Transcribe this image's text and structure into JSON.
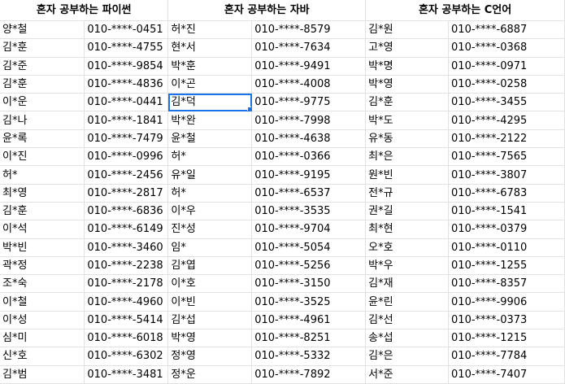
{
  "colors": {
    "grid": "#e2e2e2",
    "selection": "#1a73e8"
  },
  "groups": [
    {
      "title": "혼자 공부하는 파이썬"
    },
    {
      "title": "혼자 공부하는 자바"
    },
    {
      "title": "혼자 공부하는 C언어"
    }
  ],
  "rows": [
    [
      "양*철",
      "010-****-0451",
      "허*진",
      "010-****-8579",
      "김*원",
      "010-****-6887"
    ],
    [
      "김*훈",
      "010-****-4755",
      "현*서",
      "010-****-7634",
      "고*영",
      "010-****-0368"
    ],
    [
      "김*준",
      "010-****-9854",
      "박*훈",
      "010-****-9491",
      "박*명",
      "010-****-0971"
    ],
    [
      "김*훈",
      "010-****-4836",
      "이*곤",
      "010-****-4008",
      "박*영",
      "010-****-0258"
    ],
    [
      "이*운",
      "010-****-0441",
      "김*덕",
      "010-****-9775",
      "김*훈",
      "010-****-3455"
    ],
    [
      "김*나",
      "010-****-1841",
      "박*완",
      "010-****-7998",
      "박*도",
      "010-****-4295"
    ],
    [
      "윤*록",
      "010-****-7479",
      "윤*철",
      "010-****-4638",
      "유*동",
      "010-****-2122"
    ],
    [
      "이*진",
      "010-****-0996",
      "허*",
      "010-****-0366",
      "최*은",
      "010-****-7565"
    ],
    [
      "허*",
      "010-****-2456",
      "유*일",
      "010-****-9195",
      "원*빈",
      "010-****-3807"
    ],
    [
      "최*영",
      "010-****-2817",
      "허*",
      "010-****-6537",
      "전*규",
      "010-****-6783"
    ],
    [
      "김*훈",
      "010-****-6836",
      "이*우",
      "010-****-3535",
      "권*길",
      "010-****-1541"
    ],
    [
      "이*석",
      "010-****-6149",
      "진*성",
      "010-****-9704",
      "최*현",
      "010-****-0379"
    ],
    [
      "박*빈",
      "010-****-3460",
      "임*",
      "010-****-5054",
      "오*호",
      "010-****-0110"
    ],
    [
      "곽*정",
      "010-****-2238",
      "김*엽",
      "010-****-5256",
      "박*우",
      "010-****-1255"
    ],
    [
      "조*숙",
      "010-****-2178",
      "이*호",
      "010-****-3150",
      "김*재",
      "010-****-8357"
    ],
    [
      "이*철",
      "010-****-4960",
      "이*빈",
      "010-****-3525",
      "윤*린",
      "010-****-9906"
    ],
    [
      "이*성",
      "010-****-5414",
      "김*섭",
      "010-****-4961",
      "김*선",
      "010-****-0373"
    ],
    [
      "심*미",
      "010-****-6018",
      "박*영",
      "010-****-8251",
      "송*섭",
      "010-****-1215"
    ],
    [
      "신*호",
      "010-****-6302",
      "정*영",
      "010-****-5332",
      "김*은",
      "010-****-7784"
    ],
    [
      "김*범",
      "010-****-3481",
      "정*운",
      "010-****-7892",
      "서*준",
      "010-****-7407"
    ]
  ]
}
